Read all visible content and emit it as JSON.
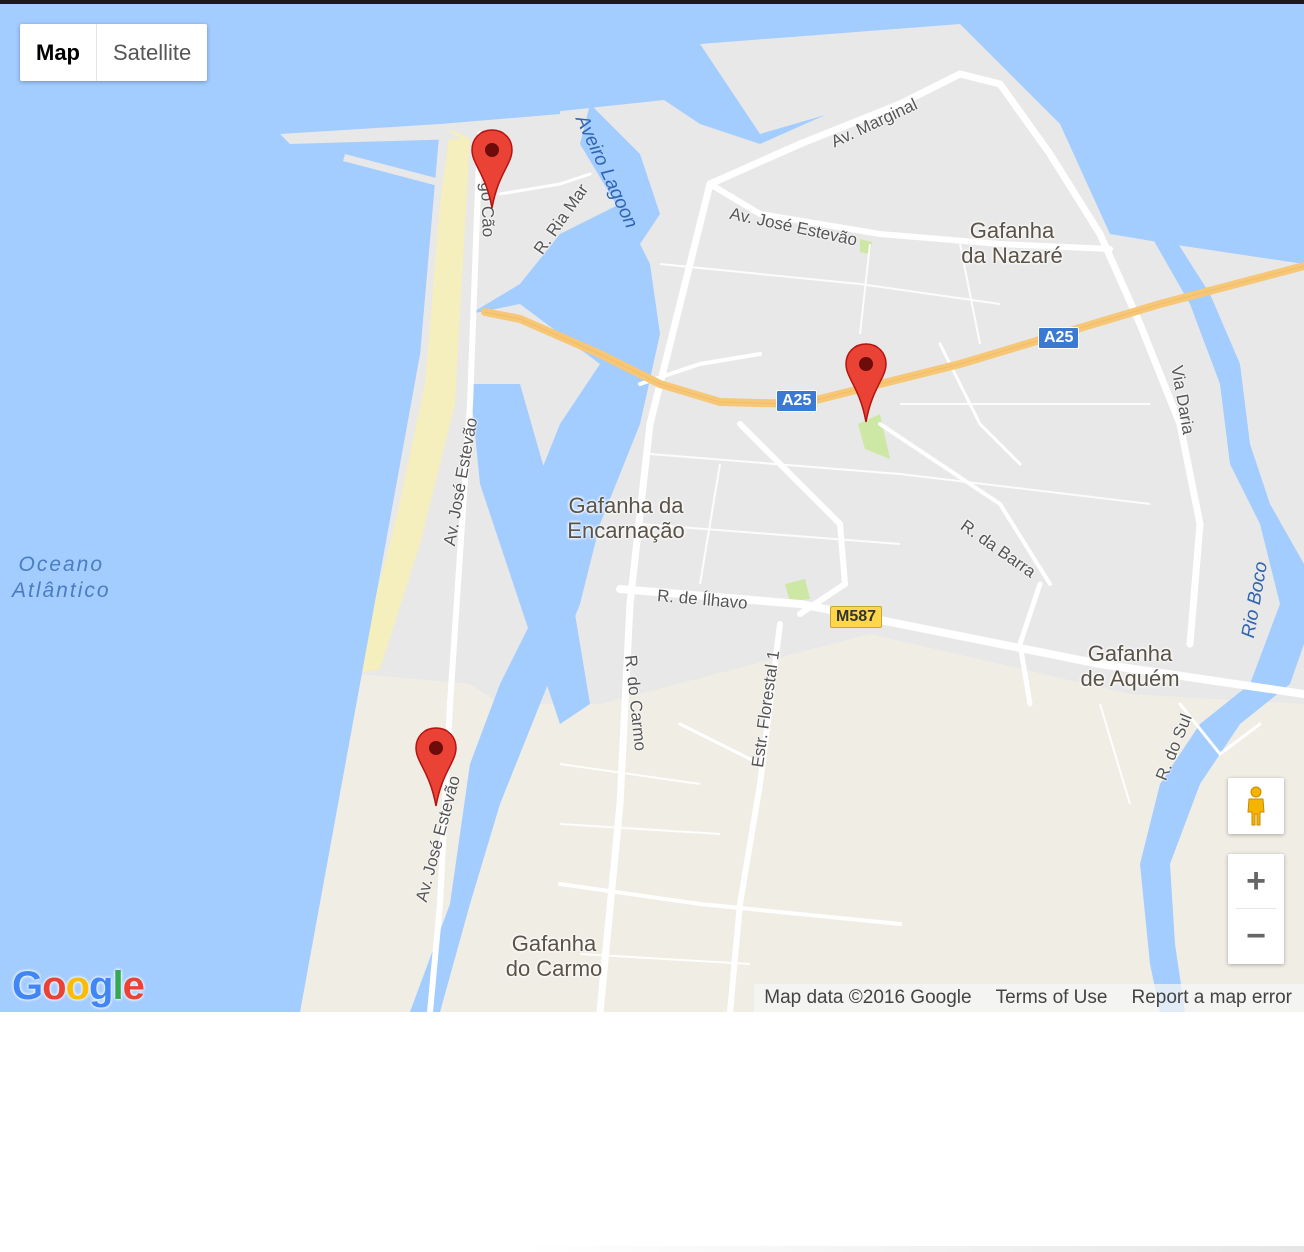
{
  "map_type": {
    "map_label": "Map",
    "satellite_label": "Satellite",
    "selected": "Map"
  },
  "places": [
    {
      "id": "gafanha-nazare",
      "line1": "Gafanha",
      "line2": "da Nazaré"
    },
    {
      "id": "gafanha-encarnacao",
      "line1": "Gafanha da",
      "line2": "Encarnação"
    },
    {
      "id": "gafanha-aquem",
      "line1": "Gafanha",
      "line2": "de Aquém"
    },
    {
      "id": "gafanha-carmo",
      "line1": "Gafanha",
      "line2": "do Carmo"
    }
  ],
  "water": {
    "ocean_line1": "Oceano",
    "ocean_line2": "Atlântico",
    "lagoon": "Aveiro Lagoon",
    "river": "Rio Boco"
  },
  "streets": {
    "marginal": "Av. Marginal",
    "jose_estevao_top": "Av. José Estevão",
    "jose_estevao_mid": "Av. José Estevão",
    "jose_estevao_bottom": "Av. José Estevão",
    "ria_mar": "R. Ria Mar",
    "cao": "go Cão",
    "barra": "R. da Barra",
    "ilhavo": "R. de Ílhavo",
    "carmo": "R. do Carmo",
    "florestal": "Estr. Florestal 1",
    "via_daria": "Via Daria",
    "sul": "R. do Sul"
  },
  "road_shields": {
    "a25_a": "A25",
    "a25_b": "A25",
    "m587": "M587"
  },
  "markers": [
    {
      "name": "marker-1",
      "color": "#ea4335"
    },
    {
      "name": "marker-2",
      "color": "#ea4335"
    },
    {
      "name": "marker-3",
      "color": "#ea4335"
    }
  ],
  "controls": {
    "zoom_in": "+",
    "zoom_out": "−",
    "pegman_icon": "pegman-icon"
  },
  "attribution": {
    "map_data": "Map data ©2016 Google",
    "terms": "Terms of Use",
    "report": "Report a map error"
  },
  "logo": {
    "text": "Google"
  },
  "colors": {
    "water": "#a3ccff",
    "land": "#e8e8e8",
    "beach": "#f5eebd",
    "sand": "#f0ede5",
    "highway": "#f6c777",
    "park": "#cde8a4"
  }
}
